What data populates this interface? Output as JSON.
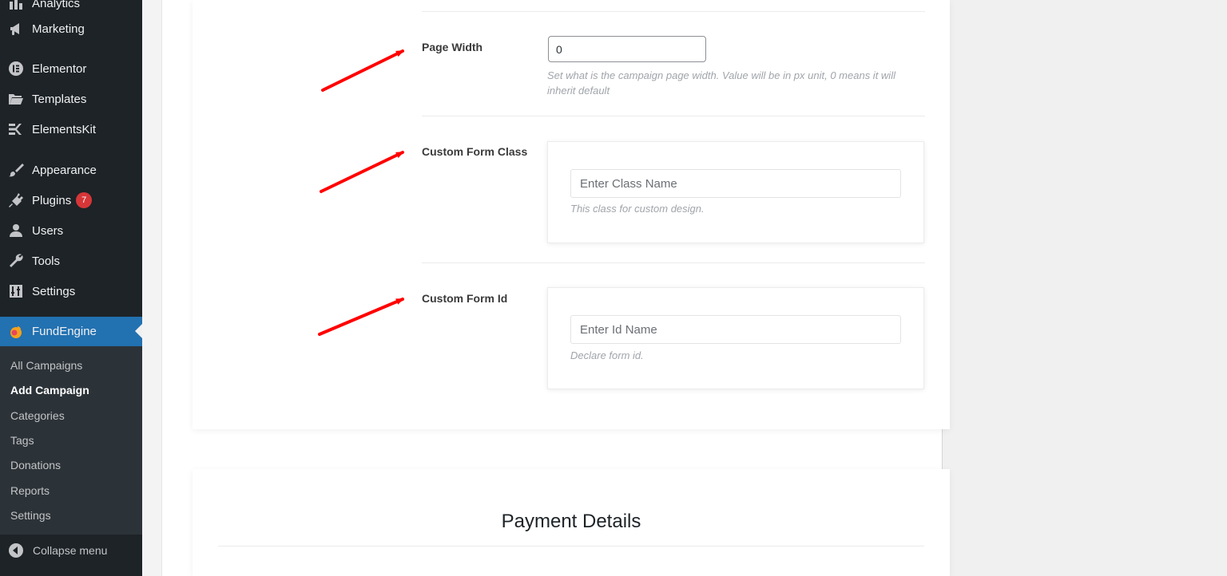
{
  "sidebar": {
    "items": [
      {
        "label": "Analytics",
        "icon": "bar-chart-icon"
      },
      {
        "label": "Marketing",
        "icon": "megaphone-icon"
      },
      {
        "label": "Elementor",
        "icon": "elementor-icon"
      },
      {
        "label": "Templates",
        "icon": "folder-icon"
      },
      {
        "label": "ElementsKit",
        "icon": "elementskit-icon"
      },
      {
        "label": "Appearance",
        "icon": "paintbrush-icon"
      },
      {
        "label": "Plugins",
        "icon": "plug-icon",
        "badge": "7"
      },
      {
        "label": "Users",
        "icon": "user-icon"
      },
      {
        "label": "Tools",
        "icon": "wrench-icon"
      },
      {
        "label": "Settings",
        "icon": "settings-icon"
      },
      {
        "label": "FundEngine",
        "icon": "fundengine-logo-icon"
      }
    ],
    "submenu": [
      "All Campaigns",
      "Add Campaign",
      "Categories",
      "Tags",
      "Donations",
      "Reports",
      "Settings"
    ],
    "current_submenu": "Add Campaign",
    "collapse_label": "Collapse menu"
  },
  "form": {
    "page_width": {
      "label": "Page Width",
      "value": "0",
      "description": "Set what is the campaign page width. Value will be in px unit, 0 means it will inherit default"
    },
    "custom_form_class": {
      "label": "Custom Form Class",
      "placeholder": "Enter Class Name",
      "description": "This class for custom design."
    },
    "custom_form_id": {
      "label": "Custom Form Id",
      "placeholder": "Enter Id Name",
      "description": "Declare form id."
    }
  },
  "payment": {
    "title": "Payment Details"
  },
  "colors": {
    "sidebar_bg": "#1d2327",
    "submenu_bg": "#2c3338",
    "active_menu_bg": "#2271b1",
    "badge_bg": "#d63638",
    "annotation_arrow": "#ff0000"
  }
}
